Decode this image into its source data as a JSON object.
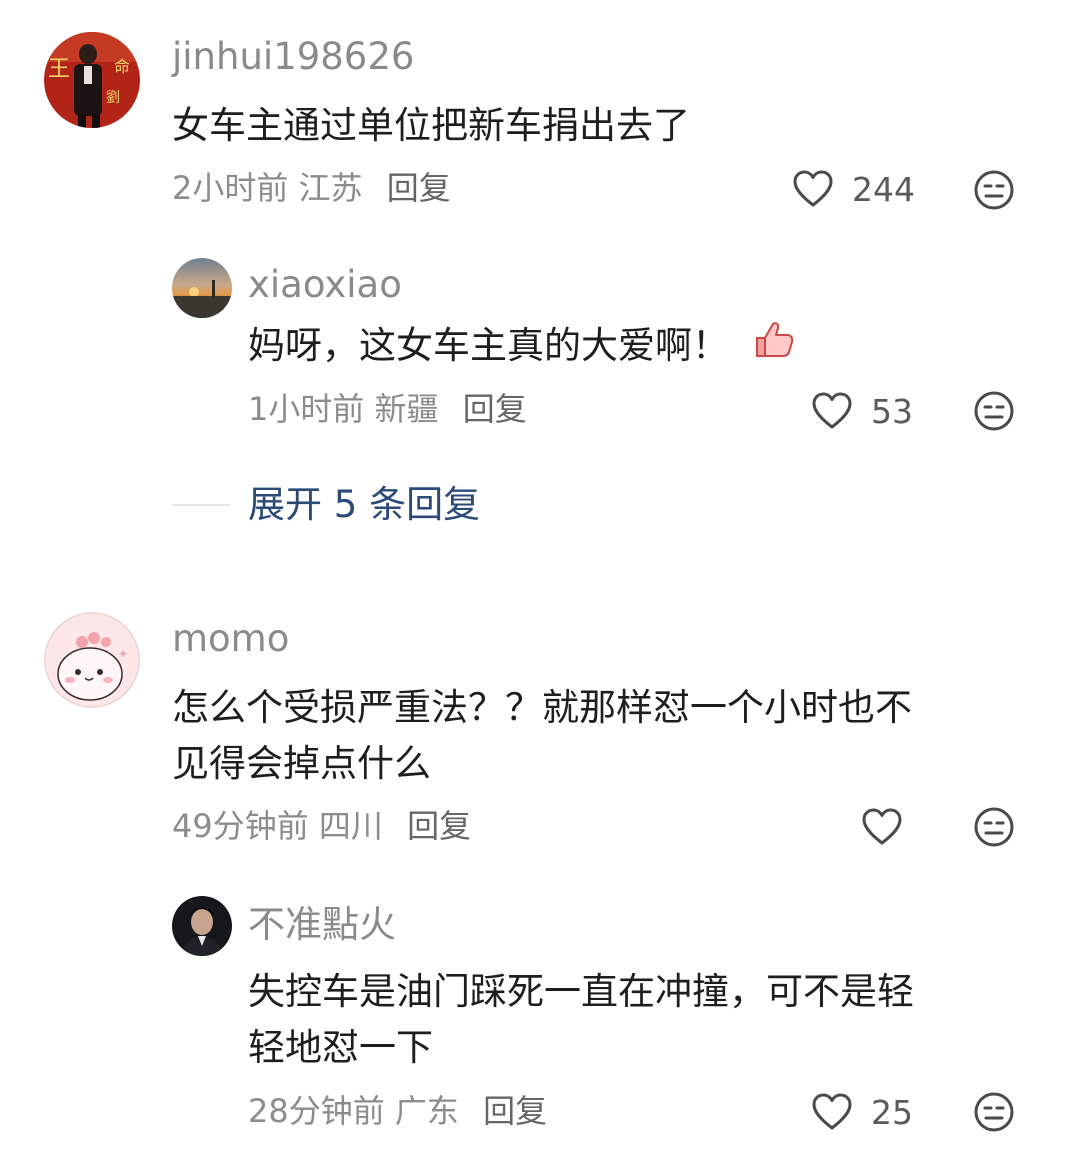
{
  "comments": [
    {
      "user": "jinhui198626",
      "text": [
        "女车主通过单位把新车捐出去了"
      ],
      "time": "2小时前",
      "location": "江苏",
      "reply_label": "回复",
      "likes": "244",
      "replies": [
        {
          "user": "xiaoxiao",
          "text": [
            "妈呀，这女车主真的大爱啊！"
          ],
          "emoji": "thumbs-up-emoji",
          "time": "1小时前",
          "location": "新疆",
          "reply_label": "回复",
          "likes": "53"
        }
      ],
      "expand_label": "展开 5 条回复"
    },
    {
      "user": "momo",
      "text": [
        "怎么个受损严重法？？就那样怼一个小时也不",
        "见得会掉点什么"
      ],
      "time": "49分钟前",
      "location": "四川",
      "reply_label": "回复",
      "likes": "",
      "replies": [
        {
          "user": "不准點火",
          "text": [
            "失控车是油门踩死一直在冲撞，可不是轻",
            "轻地怼一下"
          ],
          "time": "28分钟前",
          "location": "广东",
          "reply_label": "回复",
          "likes": "25"
        }
      ]
    }
  ],
  "icons": {
    "like": "heart-outline-icon",
    "dislike": "meh-face-icon"
  },
  "colors": {
    "username": "#8a8a8a",
    "text": "#1e1e1e",
    "meta": "#8c8c8c",
    "expand": "#2b4a77"
  }
}
